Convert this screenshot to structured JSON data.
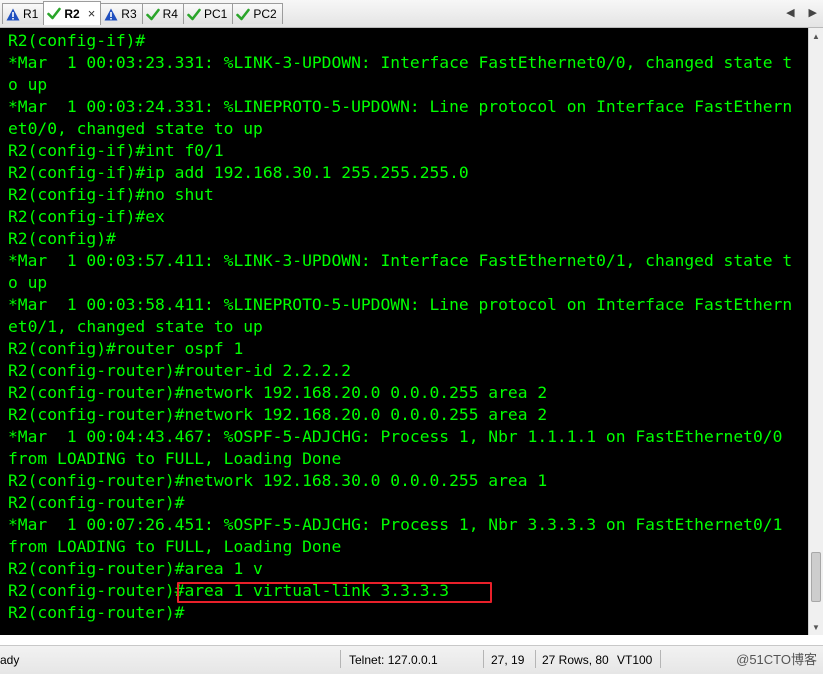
{
  "tabs": [
    {
      "label": "R1",
      "status": "warning",
      "active": false
    },
    {
      "label": "R2",
      "status": "connected",
      "active": true,
      "close": "×"
    },
    {
      "label": "R3",
      "status": "warning",
      "active": false
    },
    {
      "label": "R4",
      "status": "connected",
      "active": false
    },
    {
      "label": "PC1",
      "status": "connected",
      "active": false
    },
    {
      "label": "PC2",
      "status": "connected",
      "active": false
    }
  ],
  "colors": {
    "terminal_bg": "#000000",
    "terminal_text": "#00ff00",
    "highlight_box": "#e8202a",
    "warning_icon": "#1f4fbf",
    "check_icon": "#2aa52a"
  },
  "terminal": {
    "lines": [
      "R2(config-if)#",
      "*Mar  1 00:03:23.331: %LINK-3-UPDOWN: Interface FastEthernet0/0, changed state t",
      "o up",
      "*Mar  1 00:03:24.331: %LINEPROTO-5-UPDOWN: Line protocol on Interface FastEthern",
      "et0/0, changed state to up",
      "R2(config-if)#int f0/1",
      "R2(config-if)#ip add 192.168.30.1 255.255.255.0",
      "R2(config-if)#no shut",
      "R2(config-if)#ex",
      "R2(config)#",
      "*Mar  1 00:03:57.411: %LINK-3-UPDOWN: Interface FastEthernet0/1, changed state t",
      "o up",
      "*Mar  1 00:03:58.411: %LINEPROTO-5-UPDOWN: Line protocol on Interface FastEthern",
      "et0/1, changed state to up",
      "R2(config)#router ospf 1",
      "R2(config-router)#router-id 2.2.2.2",
      "R2(config-router)#network 192.168.20.0 0.0.0.255 area 2",
      "R2(config-router)#network 192.168.20.0 0.0.0.255 area 2",
      "*Mar  1 00:04:43.467: %OSPF-5-ADJCHG: Process 1, Nbr 1.1.1.1 on FastEthernet0/0",
      "from LOADING to FULL, Loading Done",
      "R2(config-router)#network 192.168.30.0 0.0.0.255 area 1",
      "R2(config-router)#",
      "*Mar  1 00:07:26.451: %OSPF-5-ADJCHG: Process 1, Nbr 3.3.3.3 on FastEthernet0/1",
      "from LOADING to FULL, Loading Done",
      "R2(config-router)#area 1 v",
      "R2(config-router)#area 1 virtual-link 3.3.3.3",
      "R2(config-router)#"
    ]
  },
  "status": {
    "ready": "ady",
    "connection": "Telnet: 127.0.0.1",
    "cursor": "27,  19",
    "size": "27 Rows, 80",
    "terminal_type": "VT100",
    "watermark": "@51CTO博客"
  }
}
